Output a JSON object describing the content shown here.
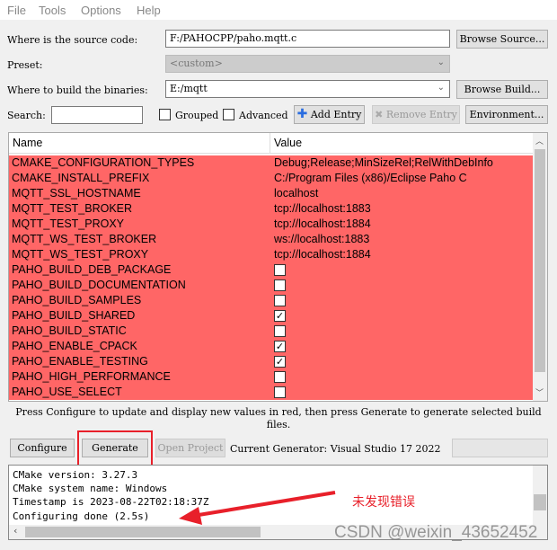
{
  "menu": [
    "File",
    "Tools",
    "Options",
    "Help"
  ],
  "source": {
    "label": "Where is the source code:",
    "value": "F:/PAHOCPP/paho.mqtt.c",
    "button": "Browse Source..."
  },
  "preset": {
    "label": "Preset:",
    "value": "<custom>"
  },
  "build": {
    "label": "Where to build the binaries:",
    "value": "E:/mqtt",
    "button": "Browse Build..."
  },
  "search": {
    "label": "Search:",
    "value": "",
    "grouped": "Grouped",
    "grouped_checked": false,
    "advanced": "Advanced",
    "advanced_checked": false,
    "add_entry": "Add Entry",
    "remove_entry": "Remove Entry",
    "environment": "Environment..."
  },
  "table": {
    "headers": [
      "Name",
      "Value"
    ],
    "row_color": "#ff6666",
    "rows": [
      {
        "name": "CMAKE_CONFIGURATION_TYPES",
        "value": "Debug;Release;MinSizeRel;RelWithDebInfo"
      },
      {
        "name": "CMAKE_INSTALL_PREFIX",
        "value": "C:/Program Files (x86)/Eclipse Paho C"
      },
      {
        "name": "MQTT_SSL_HOSTNAME",
        "value": "localhost"
      },
      {
        "name": "MQTT_TEST_BROKER",
        "value": "tcp://localhost:1883"
      },
      {
        "name": "MQTT_TEST_PROXY",
        "value": "tcp://localhost:1884"
      },
      {
        "name": "MQTT_WS_TEST_BROKER",
        "value": "ws://localhost:1883"
      },
      {
        "name": "MQTT_WS_TEST_PROXY",
        "value": "tcp://localhost:1884"
      },
      {
        "name": "PAHO_BUILD_DEB_PACKAGE",
        "checked": false
      },
      {
        "name": "PAHO_BUILD_DOCUMENTATION",
        "checked": false
      },
      {
        "name": "PAHO_BUILD_SAMPLES",
        "checked": false
      },
      {
        "name": "PAHO_BUILD_SHARED",
        "checked": true
      },
      {
        "name": "PAHO_BUILD_STATIC",
        "checked": false
      },
      {
        "name": "PAHO_ENABLE_CPACK",
        "checked": true
      },
      {
        "name": "PAHO_ENABLE_TESTING",
        "checked": true
      },
      {
        "name": "PAHO_HIGH_PERFORMANCE",
        "checked": false
      },
      {
        "name": "PAHO_USE_SELECT",
        "checked": false
      }
    ]
  },
  "hint": "Press Configure to update and display new values in red, then press Generate to generate selected build files.",
  "actions": {
    "configure": "Configure",
    "generate": "Generate",
    "open_project": "Open Project",
    "generator": "Current Generator: Visual Studio 17 2022"
  },
  "log": [
    "CMake version: 3.27.3",
    "CMake system name: Windows",
    "Timestamp is 2023-08-22T02:18:37Z",
    "Configuring done (2.5s)"
  ],
  "annotation": {
    "text": "未发现错误",
    "color": "#e8202a"
  },
  "watermark": "CSDN @weixin_43652452"
}
